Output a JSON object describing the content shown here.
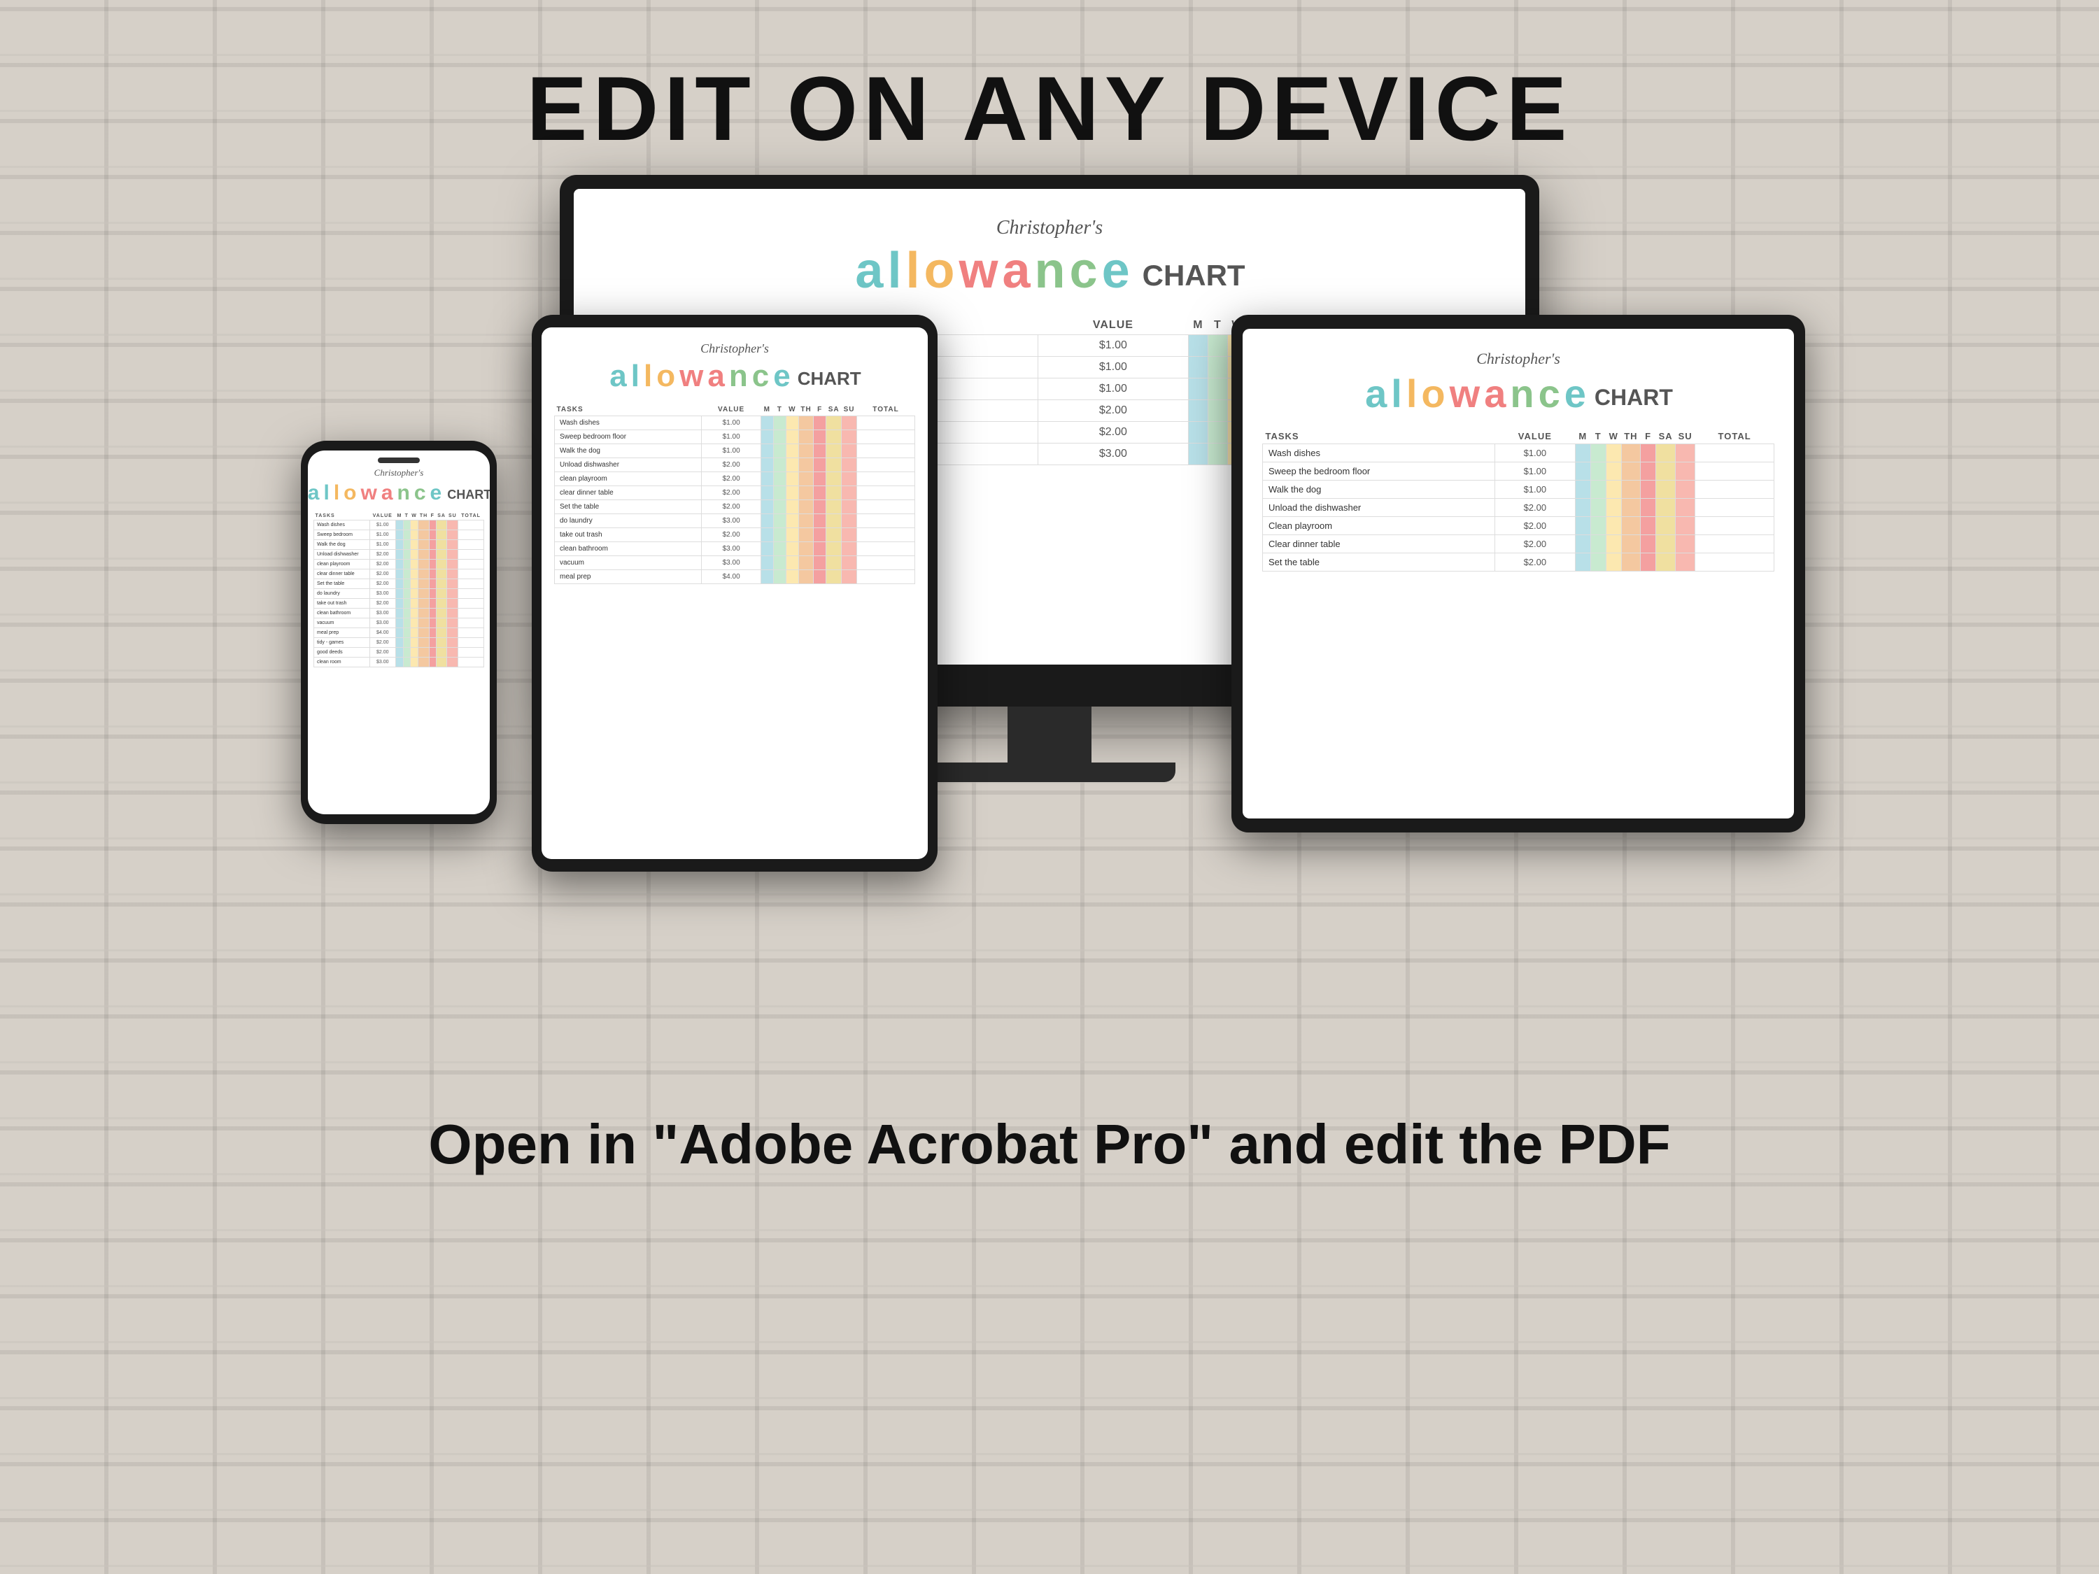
{
  "page": {
    "main_title": "EDIT ON ANY DEVICE",
    "bottom_text": "Open in \"Adobe Acrobat Pro\" and edit the PDF"
  },
  "chart": {
    "subtitle": "Christopher's",
    "word": "CHART",
    "allowance_letters": [
      "a",
      "l",
      "l",
      "o",
      "w",
      "a",
      "n",
      "c",
      "e"
    ],
    "columns": {
      "tasks": "TASKS",
      "value": "VALUE",
      "days": [
        "M",
        "T",
        "W",
        "TH",
        "F",
        "SA",
        "SU"
      ],
      "total": "TOTAL"
    },
    "tasks": [
      {
        "name": "Wash dishes",
        "value": "$1.00"
      },
      {
        "name": "Sweep the bedroom floor",
        "value": "$1.00"
      },
      {
        "name": "Walk the dog",
        "value": "$1.00"
      },
      {
        "name": "Unload the dishwasher",
        "value": "$2.00"
      },
      {
        "name": "Clean playroom",
        "value": "$2.00"
      },
      {
        "name": "Clear dinner table",
        "value": "$2.00"
      },
      {
        "name": "Set the table",
        "value": "$2.00"
      }
    ],
    "tasks_desktop": [
      {
        "name": "Wash dishes",
        "value": "$1.00"
      },
      {
        "name": "Sweep the bedroom floor",
        "value": "$1.00"
      },
      {
        "name": "Walk the dog",
        "value": "$1.00"
      },
      {
        "name": "Unload the dishwasher",
        "value": "$2.00"
      },
      {
        "name": "clean playroom",
        "value": "$2.00"
      },
      {
        "name": "clear dinner table",
        "value": "$3.00"
      }
    ]
  },
  "phone": {
    "label": "phone-device"
  },
  "tablet_left": {
    "label": "tablet-left-device"
  },
  "tablet_right": {
    "label": "tablet-right-device"
  },
  "monitor": {
    "label": "desktop-monitor"
  }
}
